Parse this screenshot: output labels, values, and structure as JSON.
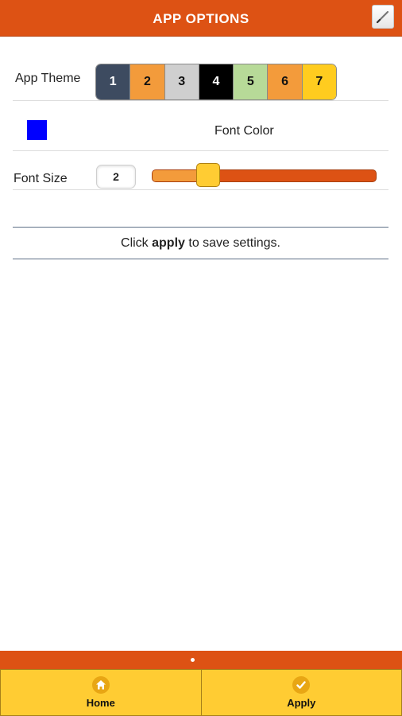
{
  "header": {
    "title": "APP OPTIONS",
    "edit_icon": "pencil-icon"
  },
  "theme": {
    "label": "App Theme",
    "options": [
      {
        "label": "1",
        "bg": "#3d4b60",
        "fg": "#ffffff"
      },
      {
        "label": "2",
        "bg": "#f39b3b",
        "fg": "#111111"
      },
      {
        "label": "3",
        "bg": "#cfcfcf",
        "fg": "#111111"
      },
      {
        "label": "4",
        "bg": "#000000",
        "fg": "#ffffff"
      },
      {
        "label": "5",
        "bg": "#b7da98",
        "fg": "#111111"
      },
      {
        "label": "6",
        "bg": "#f39b3b",
        "fg": "#111111"
      },
      {
        "label": "7",
        "bg": "#ffcc1f",
        "fg": "#111111"
      }
    ]
  },
  "font_color": {
    "label": "Font Color",
    "swatch": "#0000ff"
  },
  "font_size": {
    "label": "Font Size",
    "value": "2",
    "slider_fraction": 0.25
  },
  "save": {
    "prefix": "Click ",
    "bold": "apply",
    "suffix": " to save settings."
  },
  "footer": {
    "home_label": "Home",
    "apply_label": "Apply",
    "home_icon": "home-icon",
    "apply_icon": "check-icon"
  },
  "colors": {
    "accent": "#dd5214",
    "nav_bg": "#ffcc33"
  }
}
